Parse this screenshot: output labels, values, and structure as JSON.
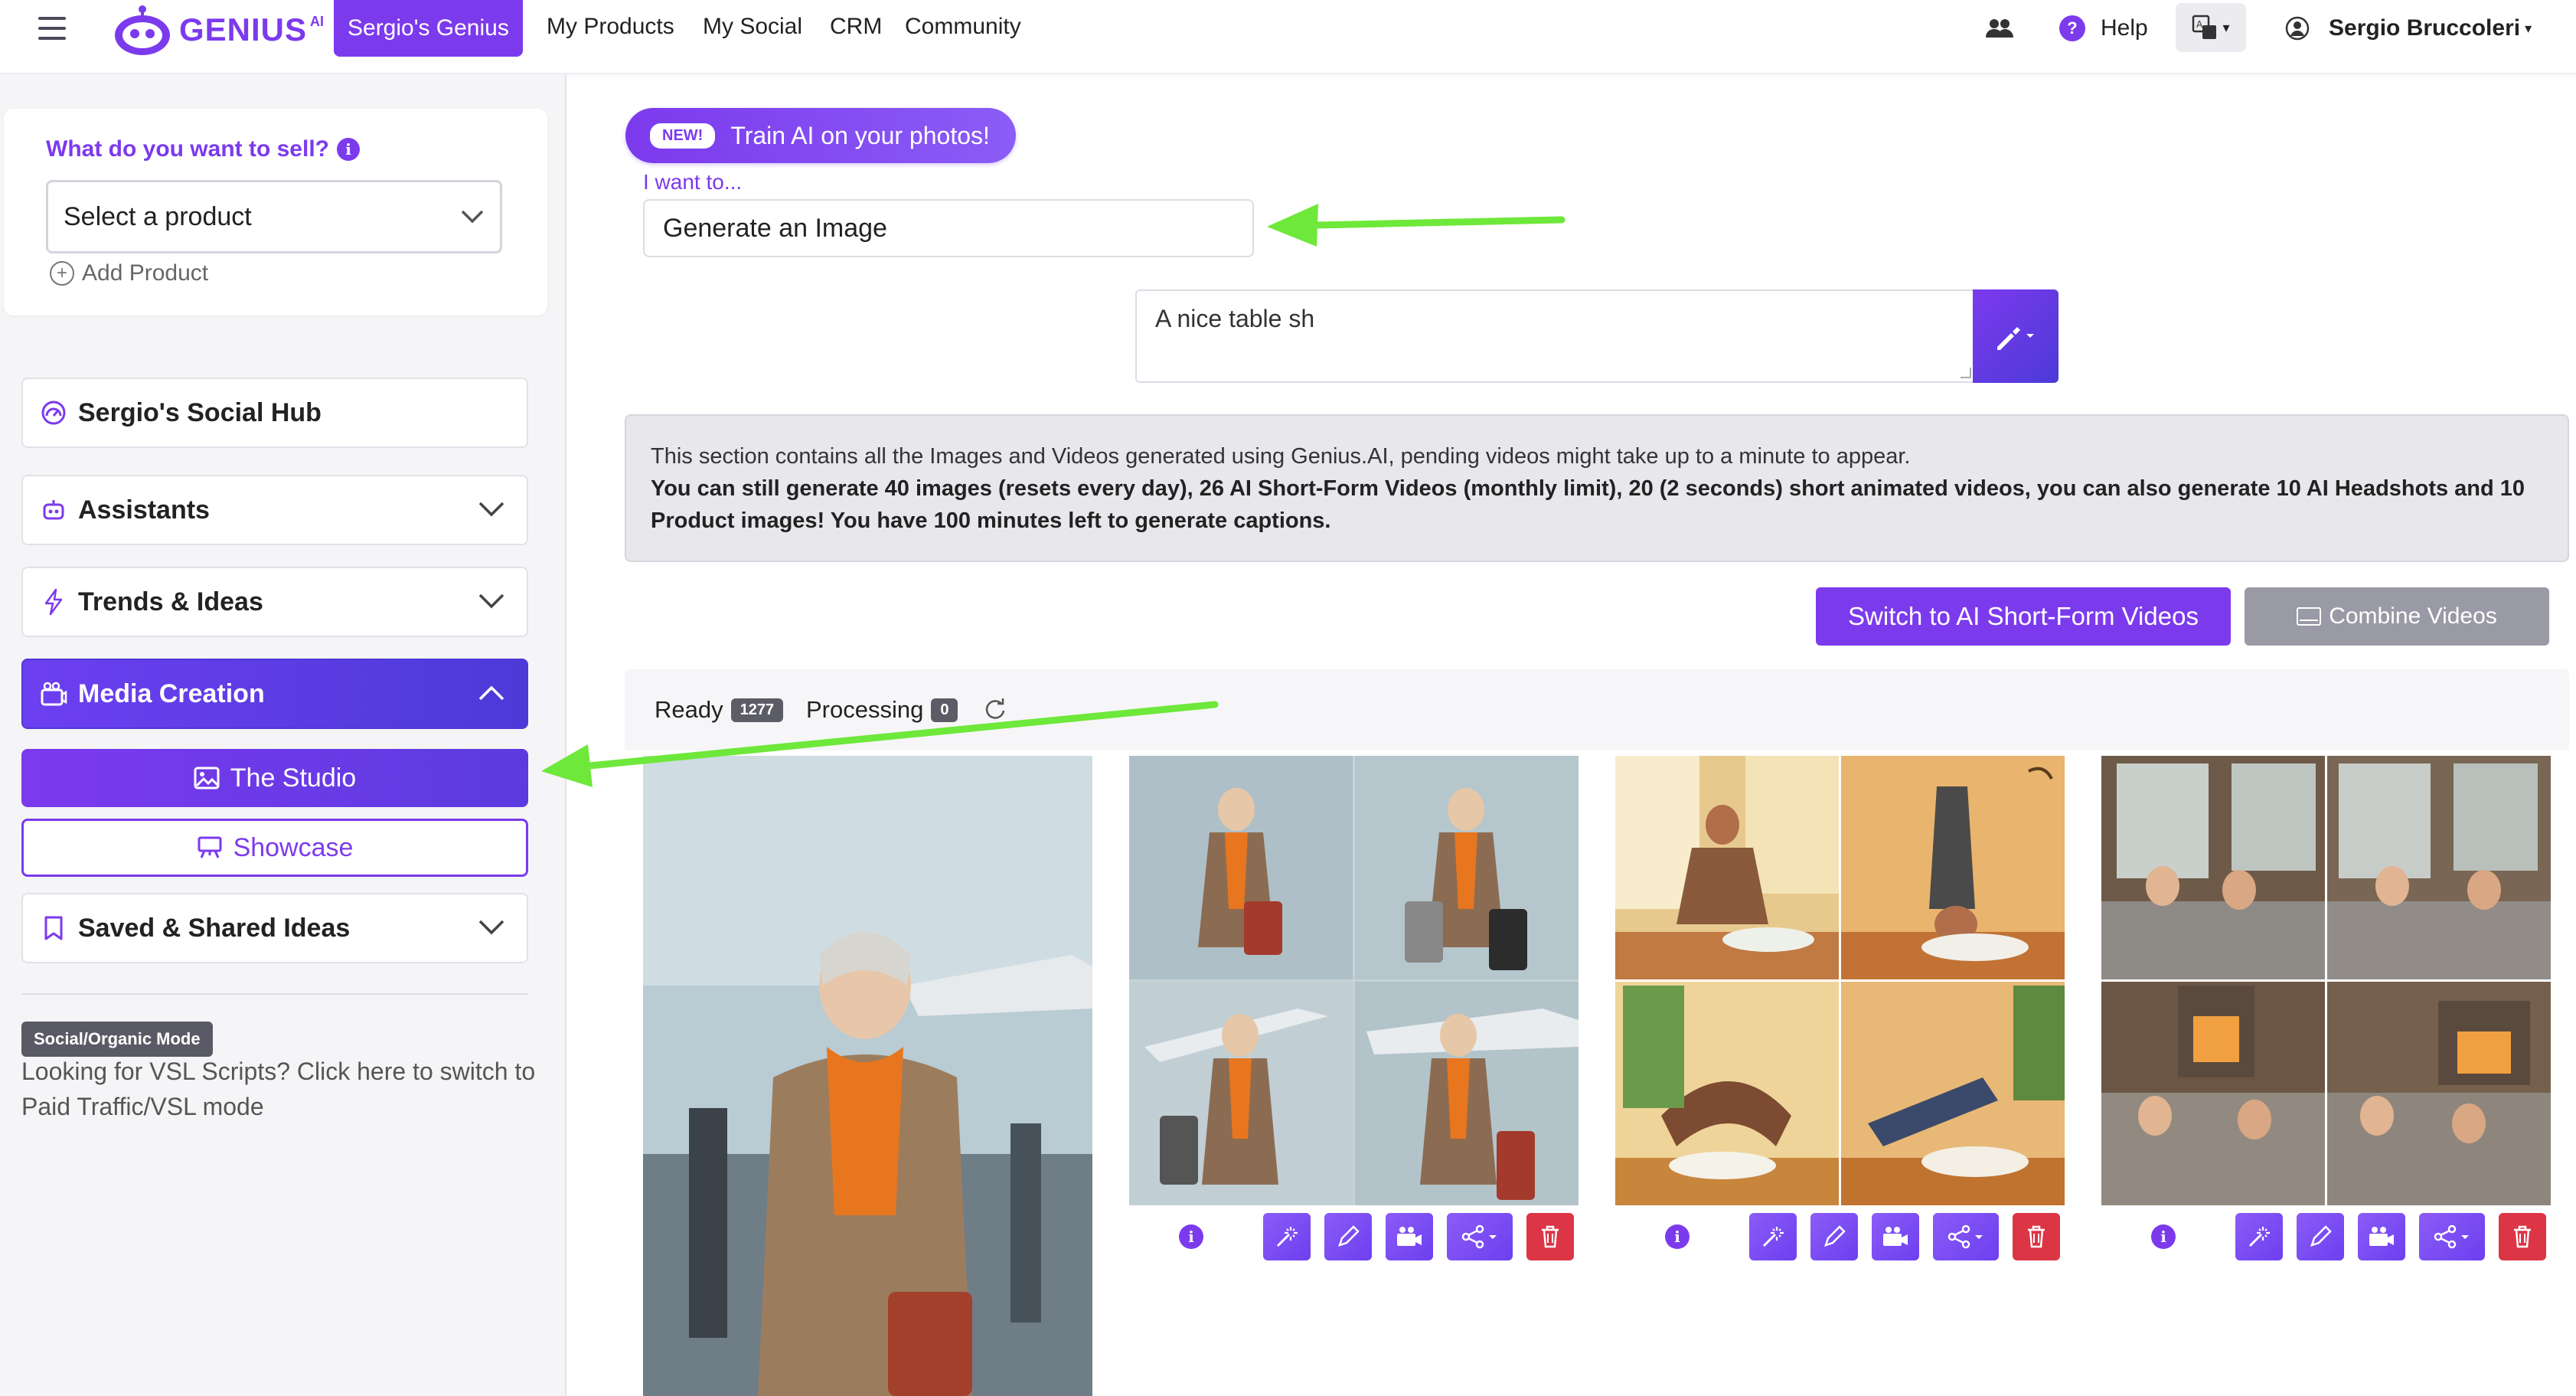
{
  "nav": {
    "logo_text": "GENIUS",
    "logo_sup": "AI",
    "brand": "Sergio's Genius",
    "links": [
      "My Products",
      "My Social",
      "CRM",
      "Community"
    ],
    "help": "Help",
    "user": "Sergio Bruccoleri"
  },
  "sidebar": {
    "sell_label": "What do you want to sell?",
    "select_value": "Select a product",
    "add_product": "Add Product",
    "items": [
      {
        "label": "Sergio's Social Hub"
      },
      {
        "label": "Assistants"
      },
      {
        "label": "Trends & Ideas"
      },
      {
        "label": "Media Creation"
      },
      {
        "label": "Saved & Shared Ideas"
      }
    ],
    "studio_label": "The Studio",
    "showcase_label": "Showcase",
    "mode_badge": "Social/Organic Mode",
    "vsl_text": "Looking for VSL Scripts? Click here to switch to Paid Traffic/VSL mode"
  },
  "main": {
    "new_tag": "NEW!",
    "train_label": "Train AI on your photos!",
    "iwant_label": "I want to...",
    "iwant_value": "Generate an Image",
    "prompt_value": "A nice table sh",
    "info_line1": "This section contains all the Images and Videos generated using Genius.AI, pending videos might take up to a minute to appear.",
    "info_line2": "You can still generate 40 images (resets every day), 26 AI Short-Form Videos (monthly limit), 20 (2 seconds) short animated videos, you can also generate 10 AI Headshots and 10 Product images! You have 100 minutes left to generate captions.",
    "switch_label": "Switch to AI Short-Form Videos",
    "combine_label": "Combine Videos",
    "tabs": [
      {
        "label": "Ready",
        "count": "1277"
      },
      {
        "label": "Processing",
        "count": "0"
      }
    ],
    "info_glyph": "i"
  },
  "colors": {
    "accent": "#7c3aed",
    "accent_dark": "#4c3ad8",
    "danger": "#dc3545",
    "arrow": "#6ee83a"
  }
}
